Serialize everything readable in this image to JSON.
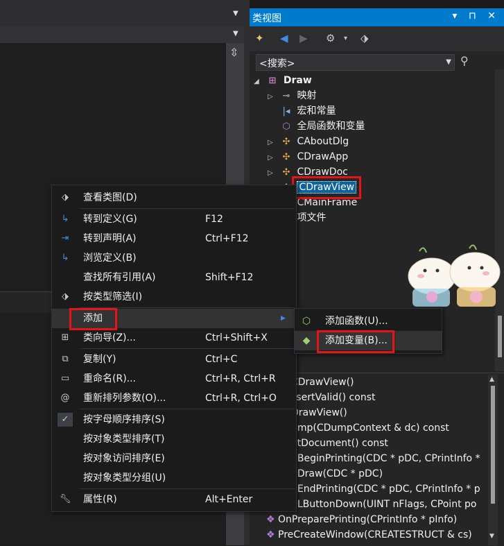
{
  "panel": {
    "title": "类视图",
    "buttons": "▾ ⊓ ✕"
  },
  "search": {
    "value": "<搜索>"
  },
  "tree": {
    "root": "Draw",
    "items": [
      {
        "label": "映射",
        "icon": "key-icon"
      },
      {
        "label": "宏和常量",
        "icon": "macro-icon"
      },
      {
        "label": "全局函数和变量",
        "icon": "cube-icon"
      },
      {
        "label": "CAboutDlg",
        "icon": "class-icon"
      },
      {
        "label": "CDrawApp",
        "icon": "class-icon"
      },
      {
        "label": "CDrawDoc",
        "icon": "class-icon"
      },
      {
        "label": "CDrawView",
        "icon": "class-icon"
      },
      {
        "label": "CMainFrame",
        "icon": "class-icon"
      },
      {
        "label": "项文件",
        "icon": "folder-icon"
      }
    ]
  },
  "members": [
    "CDrawView()",
    "ssertValid() const",
    "DrawView()",
    "ump(CDumpContext & dc) const",
    "etDocument() const",
    "nBeginPrinting(CDC * pDC, CPrintInfo *",
    "nDraw(CDC * pDC)",
    "nEndPrinting(CDC * pDC, CPrintInfo * p",
    "nLButtonDown(UINT nFlags, CPoint po",
    "OnPreparePrinting(CPrintInfo * pInfo)",
    "PreCreateWindow(CREATESTRUCT & cs)"
  ],
  "context_menu": {
    "items": [
      {
        "label": "查看类图(D)",
        "shortcut": ""
      },
      {
        "label": "转到定义(G)",
        "shortcut": "F12"
      },
      {
        "label": "转到声明(A)",
        "shortcut": "Ctrl+F12"
      },
      {
        "label": "浏览定义(B)",
        "shortcut": ""
      },
      {
        "label": "查找所有引用(A)",
        "shortcut": "Shift+F12"
      },
      {
        "label": "按类型筛选(I)",
        "shortcut": ""
      },
      {
        "label": "添加",
        "shortcut": ""
      },
      {
        "label": "类向导(Z)...",
        "shortcut": "Ctrl+Shift+X"
      },
      {
        "label": "复制(Y)",
        "shortcut": "Ctrl+C"
      },
      {
        "label": "重命名(R)...",
        "shortcut": "Ctrl+R, Ctrl+R"
      },
      {
        "label": "重新排列参数(O)...",
        "shortcut": "Ctrl+R, Ctrl+O"
      },
      {
        "label": "按字母顺序排序(S)",
        "shortcut": ""
      },
      {
        "label": "按对象类型排序(T)",
        "shortcut": ""
      },
      {
        "label": "按对象访问排序(E)",
        "shortcut": ""
      },
      {
        "label": "按对象类型分组(U)",
        "shortcut": ""
      },
      {
        "label": "属性(R)",
        "shortcut": "Alt+Enter"
      }
    ]
  },
  "submenu": {
    "items": [
      {
        "label": "添加函数(U)..."
      },
      {
        "label": "添加变量(B)..."
      }
    ]
  },
  "colors": {
    "accent": "#007acc",
    "highlight": "#e51419",
    "selection": "#0e639c"
  }
}
